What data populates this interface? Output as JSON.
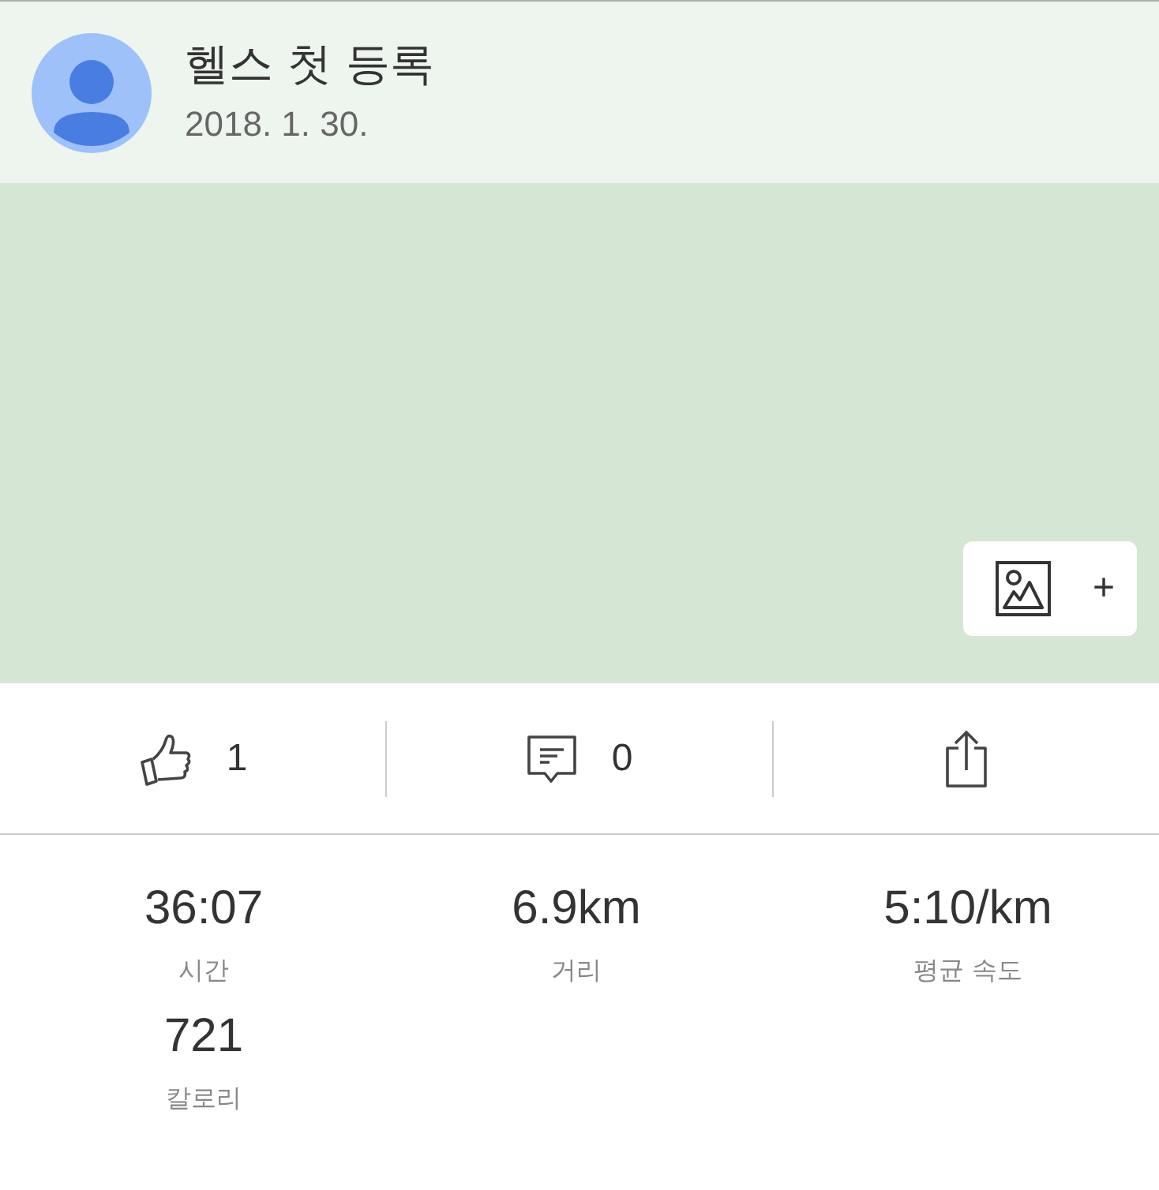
{
  "post": {
    "title": "헬스 첫 등록",
    "date": "2018. 1. 30."
  },
  "photo_area": {
    "add_label": "+"
  },
  "actions": [
    {
      "kind": "like",
      "count": "1"
    },
    {
      "kind": "comment",
      "count": "0"
    },
    {
      "kind": "share"
    }
  ],
  "stats": [
    {
      "value": "36:07",
      "label": "시간"
    },
    {
      "value": "6.9km",
      "label": "거리"
    },
    {
      "value": "5:10/km",
      "label": "평균 속도"
    },
    {
      "value": "721",
      "label": "칼로리"
    }
  ]
}
